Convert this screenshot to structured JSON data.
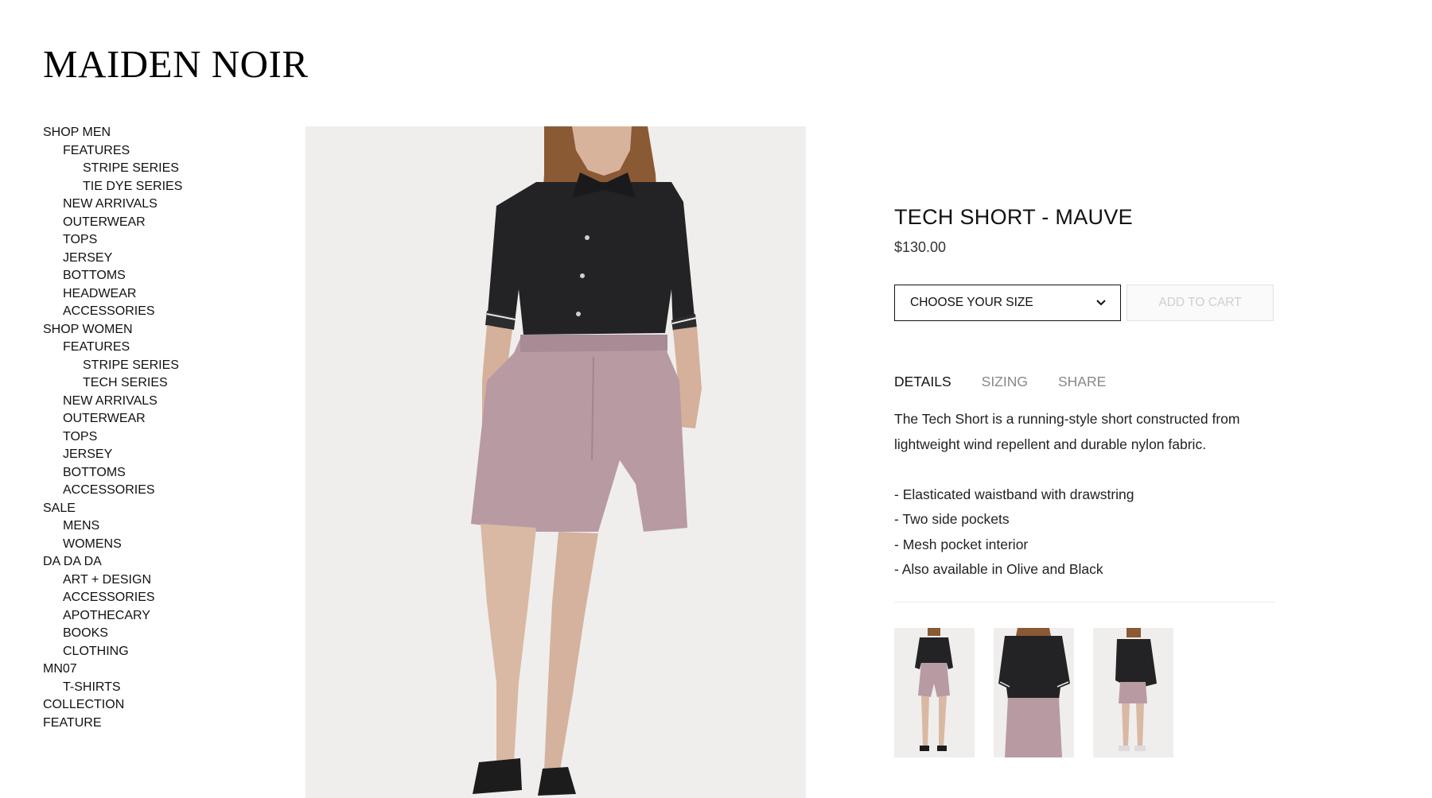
{
  "brand": {
    "logo_text": "MAIDEN NOIR"
  },
  "sidebar": {
    "items": [
      {
        "label": "SHOP MEN",
        "level": 1
      },
      {
        "label": "FEATURES",
        "level": 2
      },
      {
        "label": "STRIPE SERIES",
        "level": 3
      },
      {
        "label": "TIE DYE SERIES",
        "level": 3
      },
      {
        "label": "NEW ARRIVALS",
        "level": 2
      },
      {
        "label": "OUTERWEAR",
        "level": 2
      },
      {
        "label": "TOPS",
        "level": 2
      },
      {
        "label": "JERSEY",
        "level": 2
      },
      {
        "label": "BOTTOMS",
        "level": 2
      },
      {
        "label": "HEADWEAR",
        "level": 2
      },
      {
        "label": "ACCESSORIES",
        "level": 2
      },
      {
        "label": "SHOP WOMEN",
        "level": 1
      },
      {
        "label": "FEATURES",
        "level": 2
      },
      {
        "label": "STRIPE SERIES",
        "level": 3
      },
      {
        "label": "TECH SERIES",
        "level": 3
      },
      {
        "label": "NEW ARRIVALS",
        "level": 2
      },
      {
        "label": "OUTERWEAR",
        "level": 2
      },
      {
        "label": "TOPS",
        "level": 2
      },
      {
        "label": "JERSEY",
        "level": 2
      },
      {
        "label": "BOTTOMS",
        "level": 2
      },
      {
        "label": "ACCESSORIES",
        "level": 2
      },
      {
        "label": "SALE",
        "level": 1
      },
      {
        "label": "MENS",
        "level": 2
      },
      {
        "label": "WOMENS",
        "level": 2
      },
      {
        "label": "DA DA DA",
        "level": 1
      },
      {
        "label": "ART + DESIGN",
        "level": 2
      },
      {
        "label": "ACCESSORIES",
        "level": 2
      },
      {
        "label": "APOTHECARY",
        "level": 2
      },
      {
        "label": "BOOKS",
        "level": 2
      },
      {
        "label": "CLOTHING",
        "level": 2
      },
      {
        "label": "MN07",
        "level": 1
      },
      {
        "label": "T-SHIRTS",
        "level": 2
      },
      {
        "label": "COLLECTION",
        "level": 1
      },
      {
        "label": "FEATURE",
        "level": 1
      }
    ]
  },
  "product": {
    "title": "TECH SHORT - MAUVE",
    "price": "$130.00",
    "size_select_label": "CHOOSE YOUR SIZE",
    "add_to_cart_label": "ADD TO CART",
    "tabs": [
      {
        "label": "DETAILS",
        "active": true
      },
      {
        "label": "SIZING",
        "active": false
      },
      {
        "label": "SHARE",
        "active": false
      }
    ],
    "description": "The Tech Short is a running-style short constructed from lightweight wind repellent and durable nylon fabric.",
    "features": [
      "- Elasticated waistband with drawstring",
      "- Two side pockets",
      "- Mesh pocket interior",
      "- Also available in Olive and Black"
    ],
    "thumbnail_count": 3
  },
  "colors": {
    "shirt": "#232325",
    "shorts": "#b89aa3",
    "skin": "#d9b9a4",
    "hair": "#8a5a35",
    "background": "#efeeec",
    "disabled_text": "#cfcfcf"
  }
}
